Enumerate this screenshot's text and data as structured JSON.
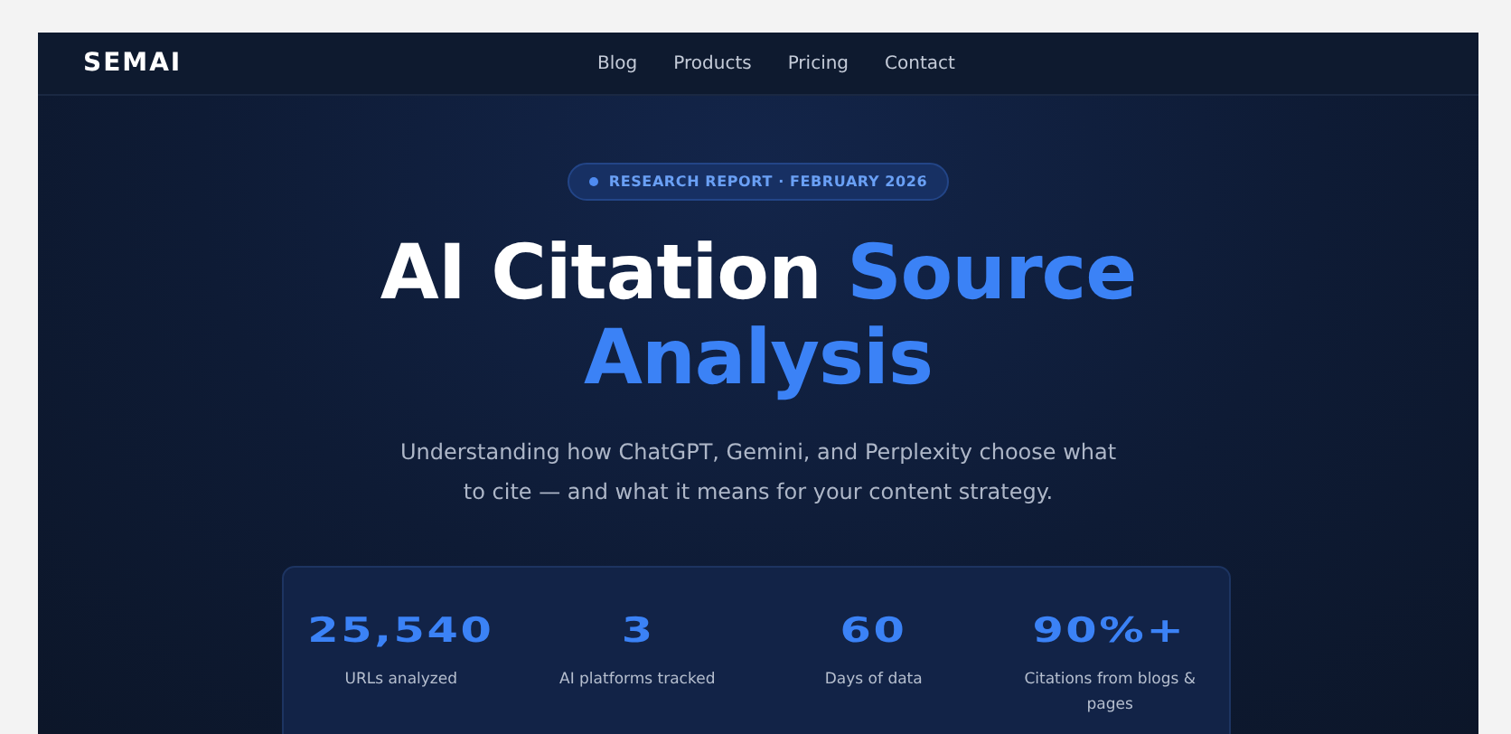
{
  "logo": "SEMAI",
  "nav": [
    {
      "label": "Blog"
    },
    {
      "label": "Products"
    },
    {
      "label": "Pricing"
    },
    {
      "label": "Contact"
    }
  ],
  "badge": "RESEARCH REPORT · FEBRUARY 2026",
  "title": {
    "white": "AI Citation",
    "blue": "Source Analysis"
  },
  "subtitle": "Understanding how ChatGPT, Gemini, and Perplexity choose what to cite — and what it means for your content strategy.",
  "stats": [
    {
      "value": "25,540",
      "label": "URLs analyzed"
    },
    {
      "value": "3",
      "label": "AI platforms tracked"
    },
    {
      "value": "60",
      "label": "Days of data"
    },
    {
      "value": "90%+",
      "label": "Citations from blogs & pages"
    }
  ]
}
